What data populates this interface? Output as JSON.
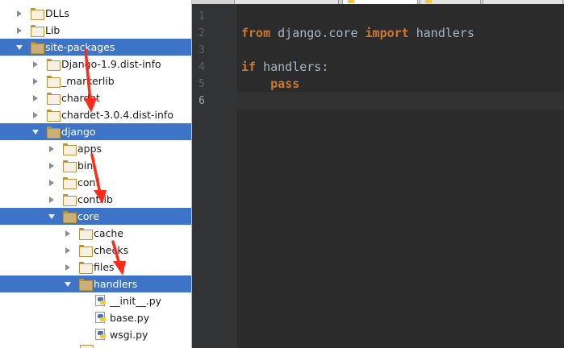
{
  "project_tree": {
    "items": [
      {
        "label": "DLLs",
        "expanded": false,
        "selected": false,
        "icon": "folder-icon"
      },
      {
        "label": "Lib",
        "expanded": false,
        "selected": false,
        "icon": "folder-icon"
      },
      {
        "label": "site-packages",
        "expanded": true,
        "selected": true,
        "icon": "folder-icon"
      },
      {
        "label": "Django-1.9.dist-info",
        "expanded": false,
        "selected": false,
        "icon": "folder-icon"
      },
      {
        "label": "_markerlib",
        "expanded": false,
        "selected": false,
        "icon": "folder-icon"
      },
      {
        "label": "chardet",
        "expanded": false,
        "selected": false,
        "icon": "folder-icon"
      },
      {
        "label": "chardet-3.0.4.dist-info",
        "expanded": false,
        "selected": false,
        "icon": "folder-icon"
      },
      {
        "label": "django",
        "expanded": true,
        "selected": true,
        "icon": "folder-icon"
      },
      {
        "label": "apps",
        "expanded": false,
        "selected": false,
        "icon": "folder-icon"
      },
      {
        "label": "bin",
        "expanded": false,
        "selected": false,
        "icon": "folder-icon"
      },
      {
        "label": "conf",
        "expanded": false,
        "selected": false,
        "icon": "folder-icon"
      },
      {
        "label": "contrib",
        "expanded": false,
        "selected": false,
        "icon": "folder-icon"
      },
      {
        "label": "core",
        "expanded": true,
        "selected": true,
        "icon": "folder-icon"
      },
      {
        "label": "cache",
        "expanded": false,
        "selected": false,
        "icon": "folder-icon"
      },
      {
        "label": "checks",
        "expanded": false,
        "selected": false,
        "icon": "folder-icon"
      },
      {
        "label": "files",
        "expanded": false,
        "selected": false,
        "icon": "folder-icon"
      },
      {
        "label": "handlers",
        "expanded": true,
        "selected": true,
        "icon": "folder-icon"
      },
      {
        "label": "__init__.py",
        "selected": false,
        "icon": "python-file-icon"
      },
      {
        "label": "base.py",
        "selected": false,
        "icon": "python-file-icon"
      },
      {
        "label": "wsgi.py",
        "selected": false,
        "icon": "python-file-icon"
      }
    ]
  },
  "editor": {
    "line_numbers": [
      "1",
      "2",
      "3",
      "4",
      "5",
      "6"
    ],
    "current_line": "6",
    "lines": [
      {
        "tokens": []
      },
      {
        "tokens": [
          {
            "t": "from",
            "kw": true
          },
          {
            "t": " django.core ",
            "kw": false
          },
          {
            "t": "import",
            "kw": true
          },
          {
            "t": " handlers",
            "kw": false
          }
        ]
      },
      {
        "tokens": []
      },
      {
        "tokens": [
          {
            "t": "if",
            "kw": true
          },
          {
            "t": " handlers:",
            "kw": false
          }
        ]
      },
      {
        "tokens": [
          {
            "t": "    ",
            "kw": false
          },
          {
            "t": "pass",
            "kw": true
          }
        ]
      },
      {
        "tokens": []
      }
    ]
  },
  "colors": {
    "selection": "#3e74c8",
    "keyword": "#cc7832",
    "identifier": "#a9b7c6",
    "editor_bg": "#2b2b2b",
    "annotation_arrow": "#ff2a1a"
  }
}
